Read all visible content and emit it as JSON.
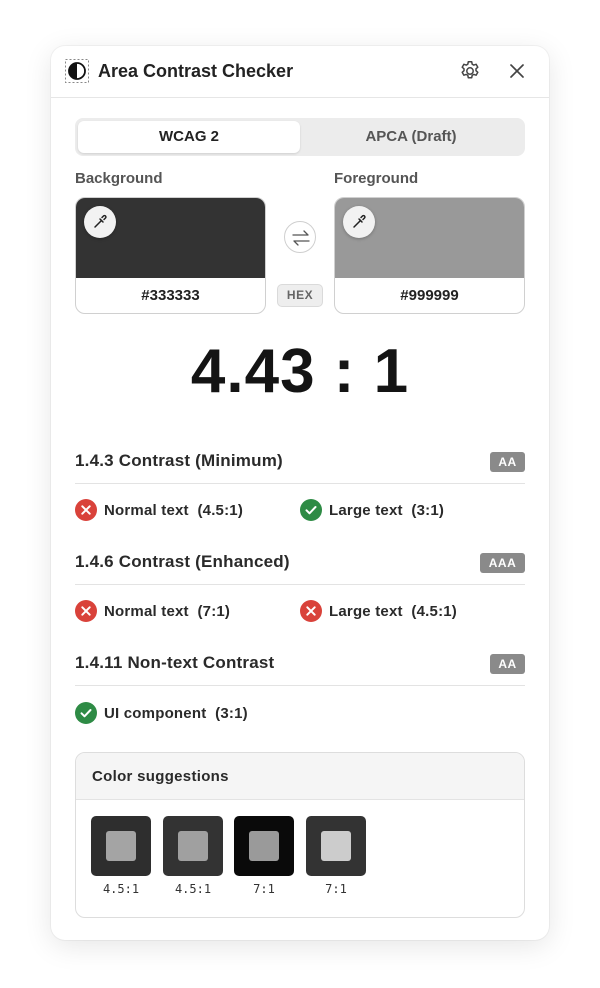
{
  "header": {
    "title": "Area Contrast Checker"
  },
  "tabs": [
    {
      "label": "WCAG 2",
      "active": true
    },
    {
      "label": "APCA (Draft)",
      "active": false
    }
  ],
  "background": {
    "label": "Background",
    "hex": "#333333",
    "color": "#333333"
  },
  "foreground": {
    "label": "Foreground",
    "hex": "#999999",
    "color": "#999999"
  },
  "hex_toggle": "HEX",
  "ratio": "4.43 : 1",
  "sections": [
    {
      "title": "1.4.3 Contrast (Minimum)",
      "badge": "AA",
      "criteria": [
        {
          "label": "Normal text  (4.5:1)",
          "pass": false
        },
        {
          "label": "Large text  (3:1)",
          "pass": true
        }
      ]
    },
    {
      "title": "1.4.6 Contrast (Enhanced)",
      "badge": "AAA",
      "criteria": [
        {
          "label": "Normal text  (7:1)",
          "pass": false
        },
        {
          "label": "Large text  (4.5:1)",
          "pass": false
        }
      ]
    },
    {
      "title": "1.4.11 Non-text Contrast",
      "badge": "AA",
      "criteria": [
        {
          "label": "UI component  (3:1)",
          "pass": true
        }
      ]
    }
  ],
  "suggestions": {
    "title": "Color suggestions",
    "items": [
      {
        "label": "4.5:1",
        "outer": "#2e2e2e",
        "inner": "#a4a4a4"
      },
      {
        "label": "4.5:1",
        "outer": "#333333",
        "inner": "#a0a0a0"
      },
      {
        "label": "7:1",
        "outer": "#0a0a0a",
        "inner": "#9a9a9a"
      },
      {
        "label": "7:1",
        "outer": "#333333",
        "inner": "#cccccc"
      }
    ]
  },
  "colors": {
    "pass": "#2e8b45",
    "fail": "#d9423a",
    "badge": "#8a8a8a"
  },
  "icons": {
    "app": "contrast-icon",
    "settings": "gear-icon",
    "close": "close-icon",
    "picker": "eyedropper-icon",
    "swap": "swap-icon",
    "pass": "check-circle-icon",
    "fail": "x-circle-icon"
  }
}
